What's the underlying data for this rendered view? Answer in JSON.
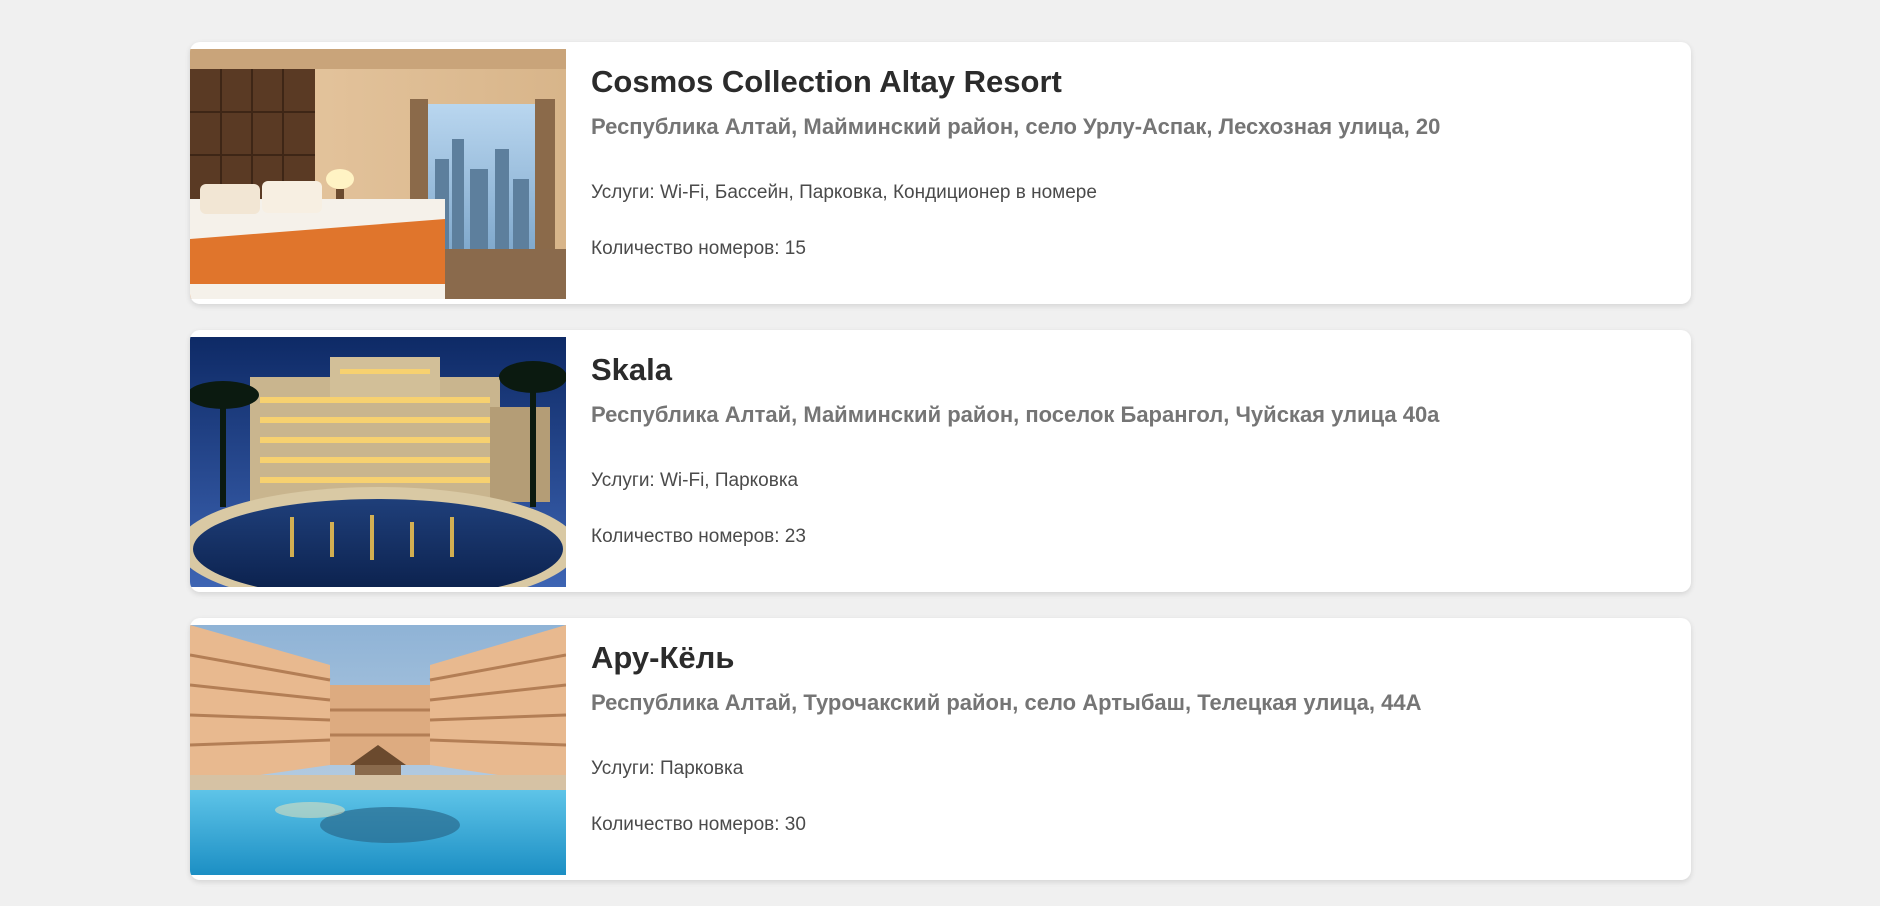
{
  "hotels": [
    {
      "name": "Cosmos Collection Altay Resort",
      "address": "Республика Алтай, Майминский район, село Урлу-Аспак, Лесхозная улица, 20",
      "services": "Услуги: Wi-Fi, Бассейн, Парковка, Кондиционер в номере",
      "rooms": "Количество номеров: 15"
    },
    {
      "name": "Skala",
      "address": "Республика Алтай, Майминский район, поселок Барангол, Чуйская улица 40а",
      "services": "Услуги: Wi-Fi, Парковка",
      "rooms": "Количество номеров: 23"
    },
    {
      "name": "Ару-Кёль",
      "address": "Республика Алтай, Турочакский район, село Артыбаш, Телецкая улица, 44А",
      "services": "Услуги: Парковка",
      "rooms": "Количество номеров: 30"
    }
  ]
}
